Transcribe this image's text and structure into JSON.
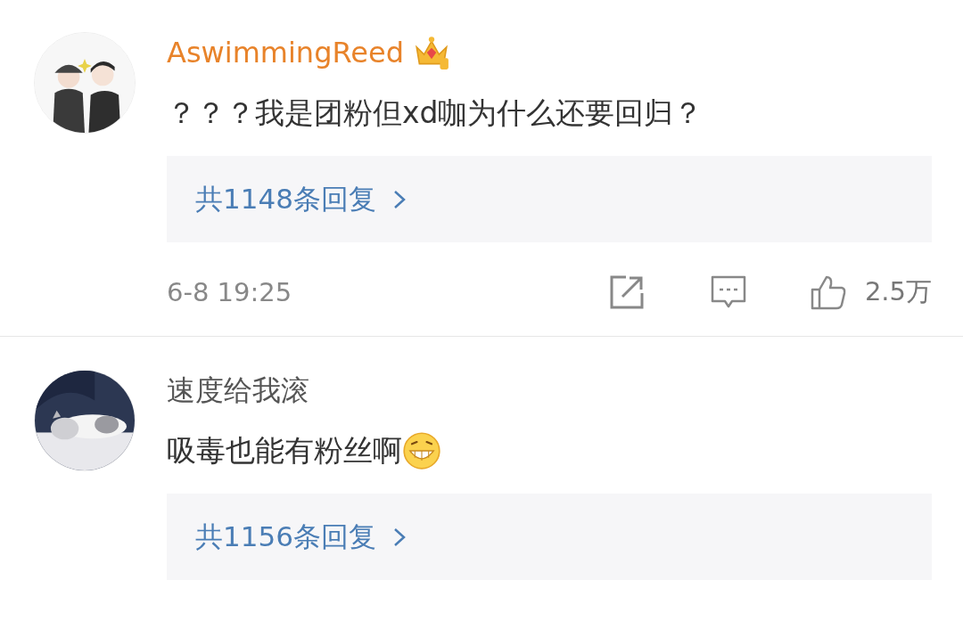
{
  "comments": [
    {
      "user": "AswimmingReed",
      "vip": true,
      "text": "？？？我是团粉但xd咖为什么还要回归？",
      "replies": "共1148条回复",
      "time": "6-8 19:25",
      "likes": "2.5万"
    },
    {
      "user": "速度给我滚",
      "vip": false,
      "text": "吸毒也能有粉丝啊",
      "emoji": {
        "kind": "grin"
      },
      "replies": "共1156条回复"
    }
  ]
}
